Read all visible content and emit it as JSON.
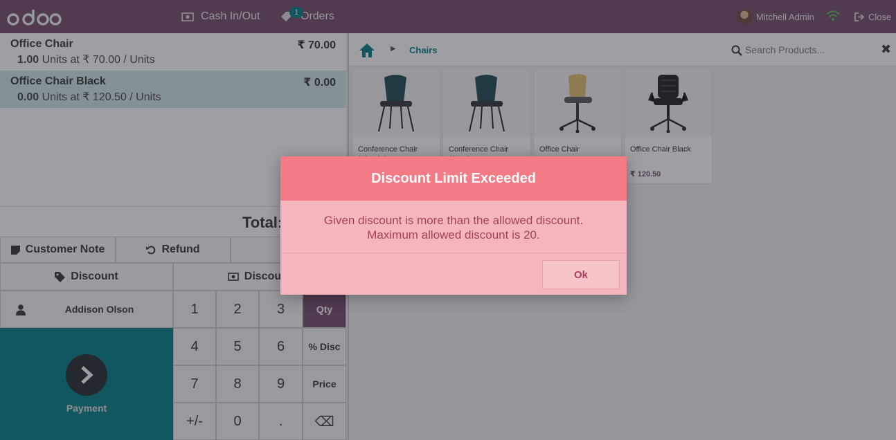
{
  "topbar": {
    "logo_text": "odoo",
    "cash_label": "Cash In/Out",
    "orders_label": "Orders",
    "orders_count": "1",
    "user_name": "Mitchell Admin",
    "close_label": "Close"
  },
  "order": {
    "lines": [
      {
        "name": "Office Chair",
        "price": "₹ 70.00",
        "qty": "1.00",
        "unit_info": "Units at ₹ 70.00 / Units"
      },
      {
        "name": "Office Chair Black",
        "price": "₹ 0.00",
        "qty": "0.00",
        "unit_info": "Units at ₹ 120.50 / Units"
      }
    ],
    "total_label": "Total:"
  },
  "controls": {
    "customer_note": "Customer Note",
    "refund": "Refund",
    "discount": "Discount",
    "discount2": "Discount"
  },
  "customer": {
    "name": "Addison Olson"
  },
  "payment": {
    "label": "Payment"
  },
  "numpad": {
    "keys": [
      "1",
      "2",
      "3",
      "Qty",
      "4",
      "5",
      "6",
      "% Disc",
      "7",
      "8",
      "9",
      "Price",
      "+/-",
      "0",
      ".",
      "⌫"
    ]
  },
  "products_panel": {
    "breadcrumb": "Chairs",
    "search_placeholder": "Search Products...",
    "products": [
      {
        "name": "Conference Chair (Aluminium, ...",
        "price": ""
      },
      {
        "name": "Conference Chair (Steel, ...",
        "price": ""
      },
      {
        "name": "Office Chair",
        "price": ""
      },
      {
        "name": "Office Chair Black",
        "price": "₹ 120.50"
      }
    ]
  },
  "dialog": {
    "title": "Discount Limit Exceeded",
    "line1": "Given discount is more than the allowed discount.",
    "line2": "Maximum allowed discount is 20.",
    "ok": "Ok"
  },
  "colors": {
    "brand": "#714b67",
    "accent": "#017e84",
    "dialog_header": "#f47a86",
    "dialog_body": "#f4b5bc"
  }
}
